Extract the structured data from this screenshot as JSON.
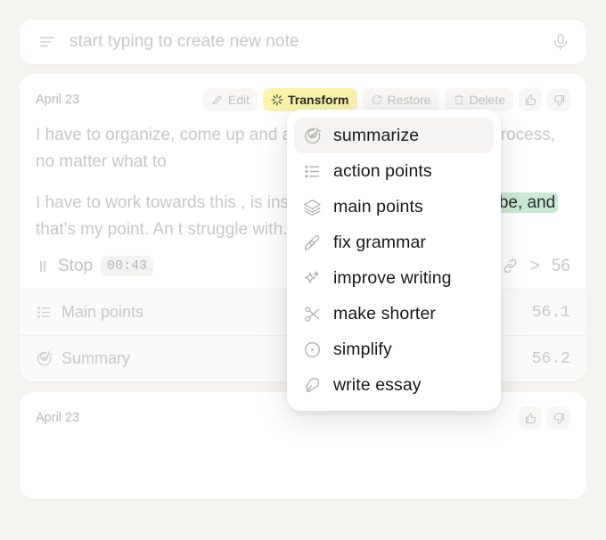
{
  "search": {
    "placeholder": "start typing to create new note",
    "left_icon": "text-lines-icon",
    "right_icon": "microphone-icon"
  },
  "note_card": {
    "date": "April 23",
    "toolbar": [
      {
        "label": "Edit",
        "icon": "pencil-icon",
        "state": "normal"
      },
      {
        "label": "Transform",
        "icon": "sparkle-icon",
        "state": "active"
      },
      {
        "label": "Restore",
        "icon": "restore-icon",
        "state": "dim"
      },
      {
        "label": "Delete",
        "icon": "trash-icon",
        "state": "dim"
      }
    ],
    "feedback": [
      {
        "icon": "thumbs-up-icon"
      },
      {
        "icon": "thumbs-down-icon"
      }
    ],
    "paragraphs": [
      {
        "pre": "I have to organize, come up ",
        "highlight": "",
        "post": "and actually have to put work in process, no matter what to"
      },
      {
        "pre": "I have to work towards this , is insane. It's always killing the ",
        "highlight": "vibe, and",
        "post": " that's my point. An t struggle with."
      }
    ],
    "paragraph_1_lines": [
      "I have to organize, come up",
      "actually have to put work in",
      "process, no matter what to"
    ],
    "paragraph_1_tail": [
      "and",
      "",
      ""
    ],
    "paragraph_2_lines": [
      "I have to work towards this",
      "insane. It's always killing th",
      "that's my point. An",
      "struggle with."
    ],
    "paragraph_2_tail": [
      ", is",
      "the",
      "t",
      ""
    ],
    "highlight_text": "vibe, and",
    "highlight_color": "#c8ead3",
    "recording": {
      "stop_label": "Stop",
      "stop_icon": "pause-icon",
      "timer": "00:43"
    },
    "meta": {
      "link_icon": "link-icon",
      "chevron": ">",
      "count": "56"
    },
    "sections": [
      {
        "label": "Main points",
        "icon": "list-icon",
        "number": "56.1"
      },
      {
        "label": "Summary",
        "icon": "target-icon",
        "number": "56.2"
      }
    ]
  },
  "transform_menu": {
    "items": [
      {
        "label": "summarize",
        "icon": "target-icon",
        "active": true
      },
      {
        "label": "action points",
        "icon": "list-icon",
        "active": false
      },
      {
        "label": "main points",
        "icon": "layers-icon",
        "active": false
      },
      {
        "label": "fix grammar",
        "icon": "pen-nib-icon",
        "active": false
      },
      {
        "label": "improve writing",
        "icon": "sparkle-star-icon",
        "active": false
      },
      {
        "label": "make shorter",
        "icon": "scissors-icon",
        "active": false
      },
      {
        "label": "simplify",
        "icon": "circle-dot-icon",
        "active": false
      },
      {
        "label": "write essay",
        "icon": "feather-icon",
        "active": false
      }
    ]
  },
  "second_card": {
    "date": "April 23",
    "feedback": [
      {
        "icon": "thumbs-up-icon"
      },
      {
        "icon": "thumbs-down-icon"
      }
    ]
  },
  "colors": {
    "background": "#f4f3ef",
    "card": "#ffffff",
    "accent_yellow": "#fbf3ac",
    "highlight_green": "#c8ead3",
    "dim_text": "#c9c8c4"
  }
}
